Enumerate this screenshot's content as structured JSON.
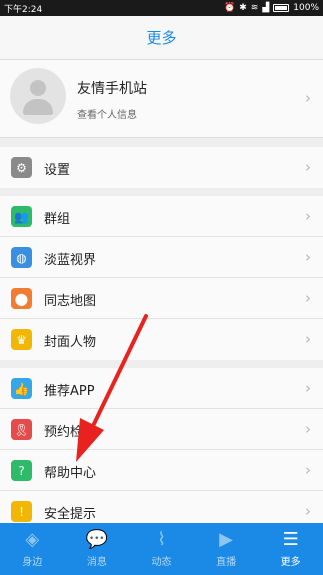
{
  "status_bar": {
    "time": "下午2:24",
    "battery": "100%"
  },
  "header": {
    "title": "更多"
  },
  "profile": {
    "name": "友情手机站",
    "subtitle": "查看个人信息"
  },
  "menu": [
    {
      "label": "设置",
      "icon": "gear-icon",
      "color": "#8a8a8a"
    },
    {
      "label": "群组",
      "icon": "group-icon",
      "color": "#2dbb6a"
    },
    {
      "label": "淡蓝视界",
      "icon": "globe-icon",
      "color": "#3a8fe0"
    },
    {
      "label": "同志地图",
      "icon": "map-pin-icon",
      "color": "#f07d32"
    },
    {
      "label": "封面人物",
      "icon": "crown-icon",
      "color": "#f2b705"
    },
    {
      "label": "推荐APP",
      "icon": "thumbs-up-icon",
      "color": "#35a6e8"
    },
    {
      "label": "预约检",
      "icon": "ribbon-icon",
      "color": "#e54b4b"
    },
    {
      "label": "帮助中心",
      "icon": "question-icon",
      "color": "#2dbb6a"
    },
    {
      "label": "安全提示",
      "icon": "shield-icon",
      "color": "#f2b705"
    }
  ],
  "tabs": [
    {
      "label": "身边",
      "icon": "compass-icon",
      "active": false
    },
    {
      "label": "消息",
      "icon": "chat-bubble-icon",
      "active": false
    },
    {
      "label": "动态",
      "icon": "feed-icon",
      "active": false
    },
    {
      "label": "直播",
      "icon": "video-camera-icon",
      "active": false
    },
    {
      "label": "更多",
      "icon": "menu-icon",
      "active": true
    }
  ],
  "colors": {
    "accent": "#1a8ae6",
    "annotation_arrow": "#e8221f"
  }
}
